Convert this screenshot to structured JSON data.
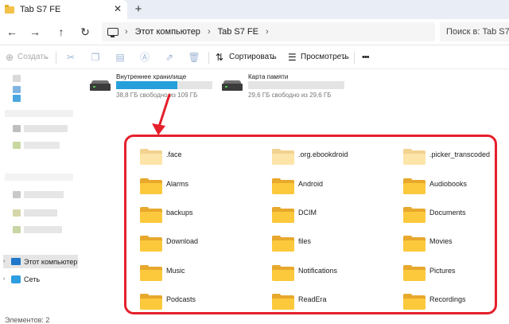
{
  "tab": {
    "title": "Tab S7 FE",
    "close": "✕",
    "new": "+"
  },
  "nav": {
    "back": "←",
    "forward": "→",
    "up": "↑",
    "refresh": "↻",
    "breadcrumb": [
      "Этот компьютер",
      "Tab S7 FE"
    ],
    "chevron": "›",
    "search_placeholder": "Поиск в: Tab S7 FE"
  },
  "toolbar": {
    "create": "Создать",
    "sort": "Сортировать",
    "view": "Просмотреть",
    "more": "•••",
    "dropdown": "⌄"
  },
  "sidebar": {
    "this_pc": "Этот компьютер",
    "network": "Сеть",
    "expand": "›",
    "status": "Элементов: 2"
  },
  "drives": [
    {
      "name": "Внутреннее хранилище",
      "info": "38,8 ГБ свободно из 109 ГБ",
      "used_percent": 64
    },
    {
      "name": "Карта памяти",
      "info": "29,6 ГБ свободно из 29,6 ГБ",
      "used_percent": 0
    }
  ],
  "folders": [
    {
      "name": ".face",
      "pale": true
    },
    {
      "name": ".org.ebookdroid",
      "pale": true
    },
    {
      "name": ".picker_transcoded",
      "pale": true
    },
    {
      "name": "Alarms",
      "pale": false
    },
    {
      "name": "Android",
      "pale": false
    },
    {
      "name": "Audiobooks",
      "pale": false
    },
    {
      "name": "backups",
      "pale": false
    },
    {
      "name": "DCIM",
      "pale": false
    },
    {
      "name": "Documents",
      "pale": false
    },
    {
      "name": "Download",
      "pale": false
    },
    {
      "name": "files",
      "pale": false
    },
    {
      "name": "Movies",
      "pale": false
    },
    {
      "name": "Music",
      "pale": false
    },
    {
      "name": "Notifications",
      "pale": false
    },
    {
      "name": "Pictures",
      "pale": false
    },
    {
      "name": "Podcasts",
      "pale": false
    },
    {
      "name": "ReadEra",
      "pale": false
    },
    {
      "name": "Recordings",
      "pale": false
    }
  ],
  "colors": {
    "highlight": "#e4202b",
    "accent": "#26a0da",
    "folder": "#fcc93c"
  }
}
